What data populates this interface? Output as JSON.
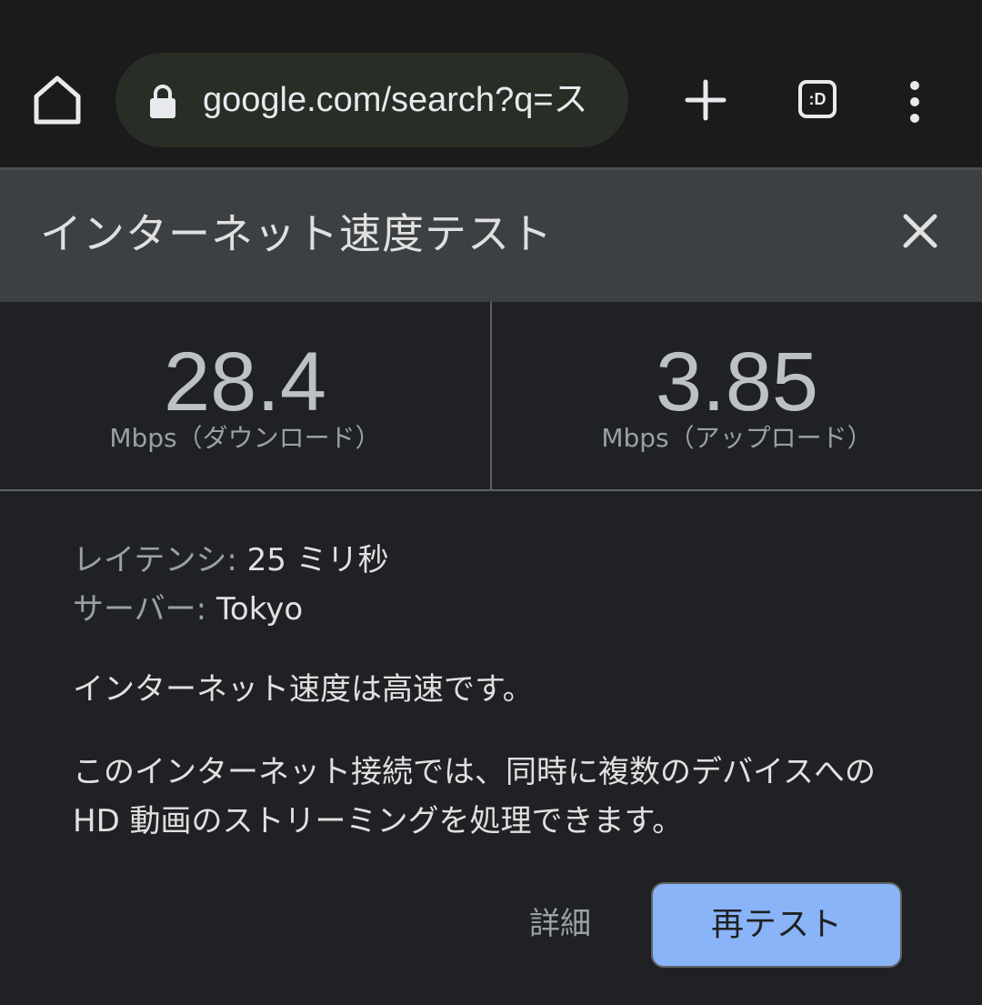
{
  "toolbar": {
    "url": "google.com/search?q=ス",
    "tab_switcher_label": ":D"
  },
  "panel": {
    "title": "インターネット速度テスト"
  },
  "results": {
    "download": {
      "value": "28.4",
      "label": "Mbps（ダウンロード）"
    },
    "upload": {
      "value": "3.85",
      "label": "Mbps（アップロード）"
    }
  },
  "info": {
    "latency_label": "レイテンシ:",
    "latency_value": "25 ミリ秒",
    "server_label": "サーバー:",
    "server_value": "Tokyo"
  },
  "description": {
    "summary": "インターネット速度は高速です。",
    "detail": "このインターネット接続では、同時に複数のデバイスへの HD 動画のストリーミングを処理できます。"
  },
  "actions": {
    "details_label": "詳細",
    "retest_label": "再テスト"
  },
  "colors": {
    "accent": "#8ab4f8",
    "background": "#202124",
    "header": "#3c4043"
  },
  "icons": [
    "home-icon",
    "lock-icon",
    "plus-icon",
    "tab-switcher-icon",
    "more-vert-icon",
    "close-icon"
  ]
}
